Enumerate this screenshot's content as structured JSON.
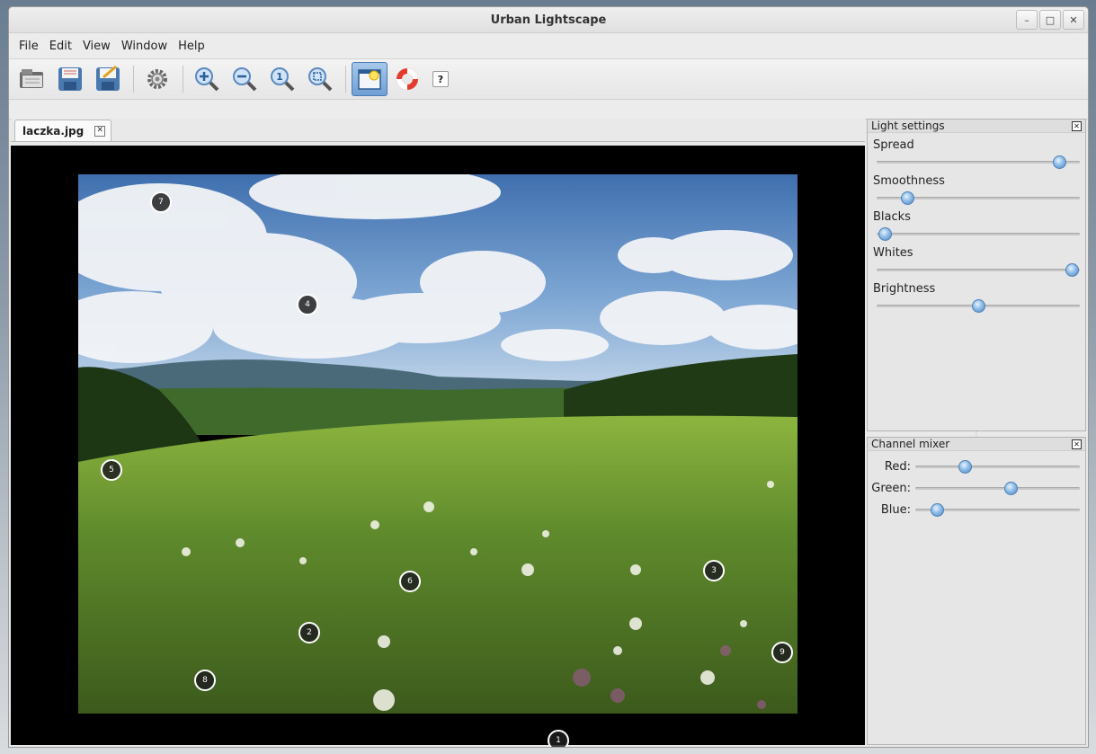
{
  "window": {
    "title": "Urban Lightscape"
  },
  "menu": [
    "File",
    "Edit",
    "View",
    "Window",
    "Help"
  ],
  "toolbar": {
    "buttons": [
      "open-icon",
      "save-icon",
      "save-as-icon",
      "settings-icon",
      "zoom-in-icon",
      "zoom-out-icon",
      "zoom-original-icon",
      "zoom-fit-icon",
      "light-icon",
      "lifebuoy-icon"
    ],
    "help_label": "?"
  },
  "document": {
    "tab_label": "laczka.jpg",
    "markers": [
      {
        "label": "1"
      },
      {
        "label": "2"
      },
      {
        "label": "3"
      },
      {
        "label": "4"
      },
      {
        "label": "5"
      },
      {
        "label": "6"
      },
      {
        "label": "7"
      },
      {
        "label": "8"
      },
      {
        "label": "9"
      }
    ]
  },
  "light_settings": {
    "title": "Light settings",
    "sliders": [
      {
        "label": "Spread",
        "value": 0.9
      },
      {
        "label": "Smoothness",
        "value": 0.15
      },
      {
        "label": "Blacks",
        "value": 0.04
      },
      {
        "label": "Whites",
        "value": 0.96
      },
      {
        "label": "Brightness",
        "value": 0.5
      }
    ]
  },
  "channel_mixer": {
    "title": "Channel mixer",
    "channels": [
      {
        "label": "Red:",
        "value": 0.3
      },
      {
        "label": "Green:",
        "value": 0.58
      },
      {
        "label": "Blue:",
        "value": 0.13
      }
    ]
  }
}
